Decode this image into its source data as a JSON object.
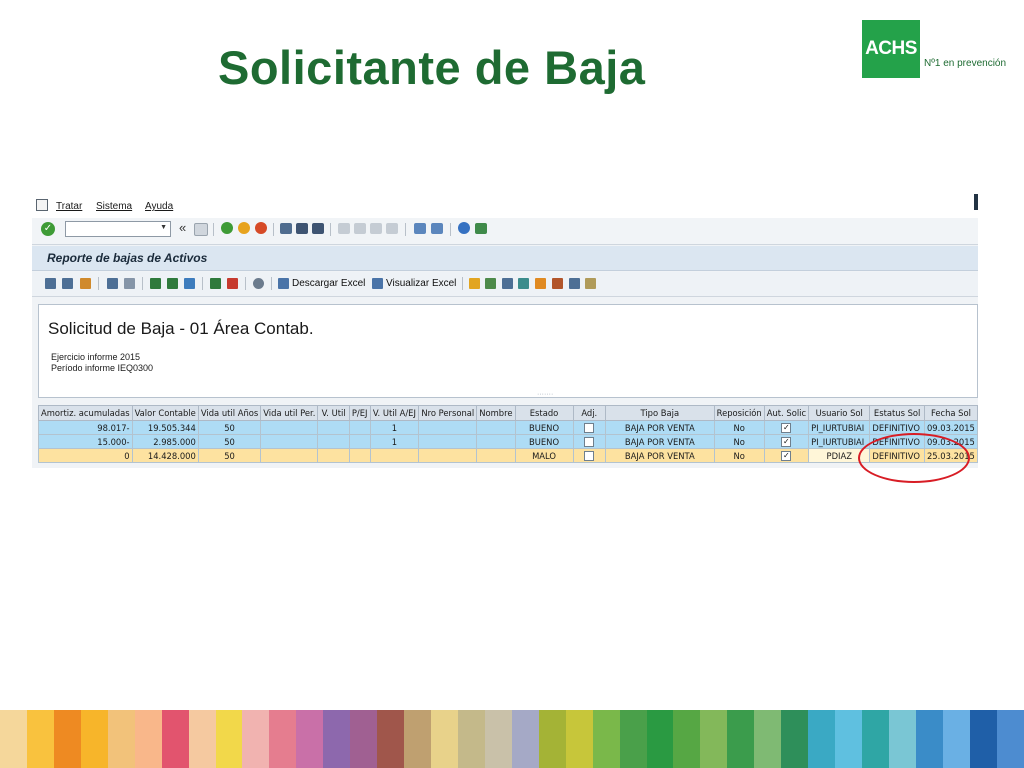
{
  "slide": {
    "title": "Solicitante de Baja"
  },
  "logo": {
    "brand": "ACHS",
    "tagline": "Nº1 en prevención",
    "color": "#24a24a"
  },
  "sap": {
    "menu": [
      "Tratar",
      "Sistema",
      "Ayuda"
    ],
    "double_arrow": "«",
    "titlebar": "Reporte de bajas de Activos",
    "app_toolbar": {
      "download_excel": "Descargar Excel",
      "view_excel": "Visualizar Excel"
    },
    "report": {
      "title": "Solicitud de Baja - 01 Área Contab.",
      "lines": [
        "Ejercicio informe 2015",
        "Período informe IEQ0300"
      ]
    },
    "table": {
      "columns": [
        "Amortiz. acumuladas",
        "Valor Contable",
        "Vida util Años",
        "Vida util Per.",
        "V. Util",
        "P/EJ",
        "V. Util A/EJ",
        "Nro Personal",
        "Nombre",
        "Estado",
        "Adj.",
        "Tipo Baja",
        "Reposición",
        "Aut. Solic",
        "Usuario Sol",
        "Estatus Sol",
        "Fecha Sol"
      ],
      "rows": [
        {
          "amortiz": "98.017-",
          "valor": "19.505.344",
          "vida_anos": "50",
          "vida_per": "",
          "v_util": "",
          "p_ej": "",
          "v_util_aej": "1",
          "nro_personal": "",
          "nombre": "",
          "estado": "BUENO",
          "adj": false,
          "tipo_baja": "BAJA POR VENTA",
          "reposicion": "No",
          "aut_solic": true,
          "usuario": "PI_IURTUBIAI",
          "estatus": "DEFINITIVO",
          "fecha": "09.03.2015"
        },
        {
          "amortiz": "15.000-",
          "valor": "2.985.000",
          "vida_anos": "50",
          "vida_per": "",
          "v_util": "",
          "p_ej": "",
          "v_util_aej": "1",
          "nro_personal": "",
          "nombre": "",
          "estado": "BUENO",
          "adj": false,
          "tipo_baja": "BAJA POR VENTA",
          "reposicion": "No",
          "aut_solic": true,
          "usuario": "PI_IURTUBIAI",
          "estatus": "DEFINITIVO",
          "fecha": "09.03.2015"
        },
        {
          "amortiz": "0",
          "valor": "14.428.000",
          "vida_anos": "50",
          "vida_per": "",
          "v_util": "",
          "p_ej": "",
          "v_util_aej": "",
          "nro_personal": "",
          "nombre": "",
          "estado": "MALO",
          "adj": false,
          "tipo_baja": "BAJA POR VENTA",
          "reposicion": "No",
          "aut_solic": true,
          "usuario": "PDIAZ",
          "estatus": "DEFINITIVO",
          "fecha": "25.03.2015"
        }
      ]
    }
  },
  "colors": {
    "title": "#1e6b32",
    "row_blue": "#aedcf5",
    "row_yellow": "#fde2a0",
    "highlight_ellipse": "#d81d25",
    "stripes": [
      "#f5d79b",
      "#f9c23e",
      "#ee8a22",
      "#f7b52a",
      "#f2c27a",
      "#f9b78a",
      "#e2546e",
      "#f5c9a0",
      "#f2d84a",
      "#f1b3b0",
      "#e57d8f",
      "#c970a8",
      "#8d68ad",
      "#a06092",
      "#a0564b",
      "#bfa070",
      "#e8d28a",
      "#c4b98a",
      "#c9c1a9",
      "#a5a9c6",
      "#a4b336",
      "#c7c63a",
      "#7ab84a",
      "#4aa04a",
      "#2a9a42",
      "#56a744",
      "#83b85a",
      "#3b9c4c",
      "#7fba73",
      "#2e8f5a",
      "#3aa9c4",
      "#5fc0e0",
      "#2fa6a5",
      "#7ac6d4",
      "#3a8cc8",
      "#6ab0e4",
      "#1f5fa8",
      "#4d8cd0"
    ]
  }
}
